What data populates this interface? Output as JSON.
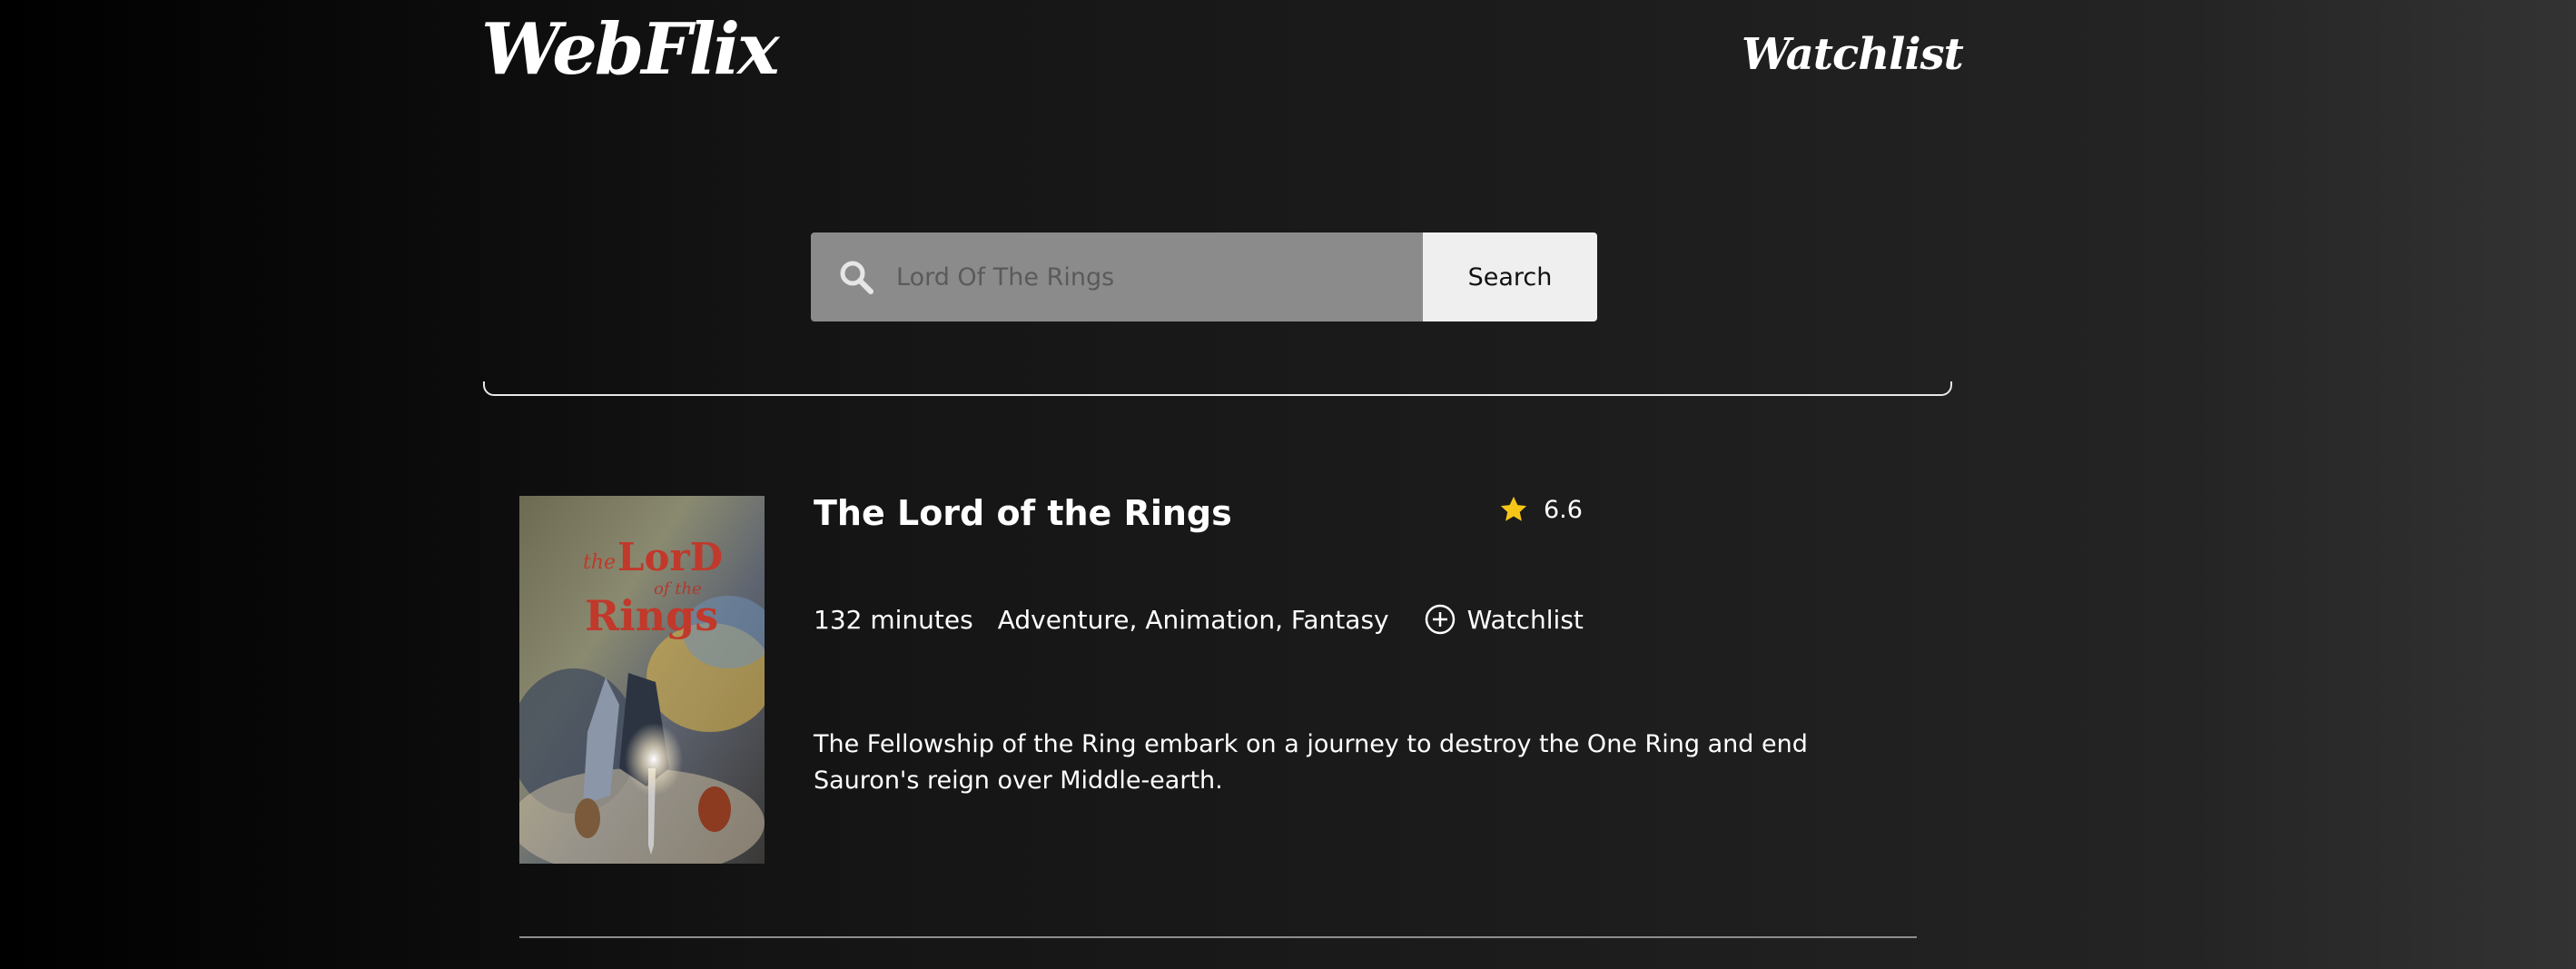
{
  "header": {
    "logo": "WebFlix",
    "nav_watchlist": "Watchlist"
  },
  "search": {
    "placeholder": "Lord Of The Rings",
    "value": "",
    "button_label": "Search",
    "icon": "search-icon"
  },
  "movie": {
    "title": "The Lord of the Rings",
    "rating": "6.6",
    "runtime": "132 minutes",
    "genres": "Adventure, Animation, Fantasy",
    "watchlist_label": "Watchlist",
    "plot": "The Fellowship of the Ring embark on a journey to destroy the One Ring and end Sauron's reign over Middle-earth.",
    "poster": {
      "title_words": [
        "the",
        "LorD",
        "of the",
        "Rings"
      ]
    }
  },
  "colors": {
    "star": "#f5c518",
    "search_field": "#8b8b8b",
    "search_button": "#efefef"
  }
}
